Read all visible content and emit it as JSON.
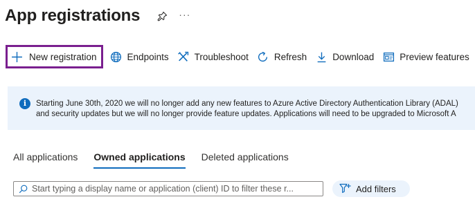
{
  "header": {
    "title": "App registrations",
    "more_label": "···"
  },
  "toolbar": {
    "new_registration": "New registration",
    "endpoints": "Endpoints",
    "troubleshoot": "Troubleshoot",
    "refresh": "Refresh",
    "download": "Download",
    "preview_features": "Preview features"
  },
  "info_banner": {
    "line1": "Starting June 30th, 2020 we will no longer add any new features to Azure Active Directory Authentication Library (ADAL)",
    "line2": "and security updates but we will no longer provide feature updates. Applications will need to be upgraded to Microsoft A"
  },
  "tabs": [
    {
      "label": "All applications",
      "active": false
    },
    {
      "label": "Owned applications",
      "active": true
    },
    {
      "label": "Deleted applications",
      "active": false
    }
  ],
  "search": {
    "placeholder": "Start typing a display name or application (client) ID to filter these r..."
  },
  "filters": {
    "add_label": "Add filters"
  },
  "colors": {
    "accent": "#0f6cbd",
    "highlight_border": "#7a1f8f",
    "banner_bg": "#ebf3fc"
  }
}
